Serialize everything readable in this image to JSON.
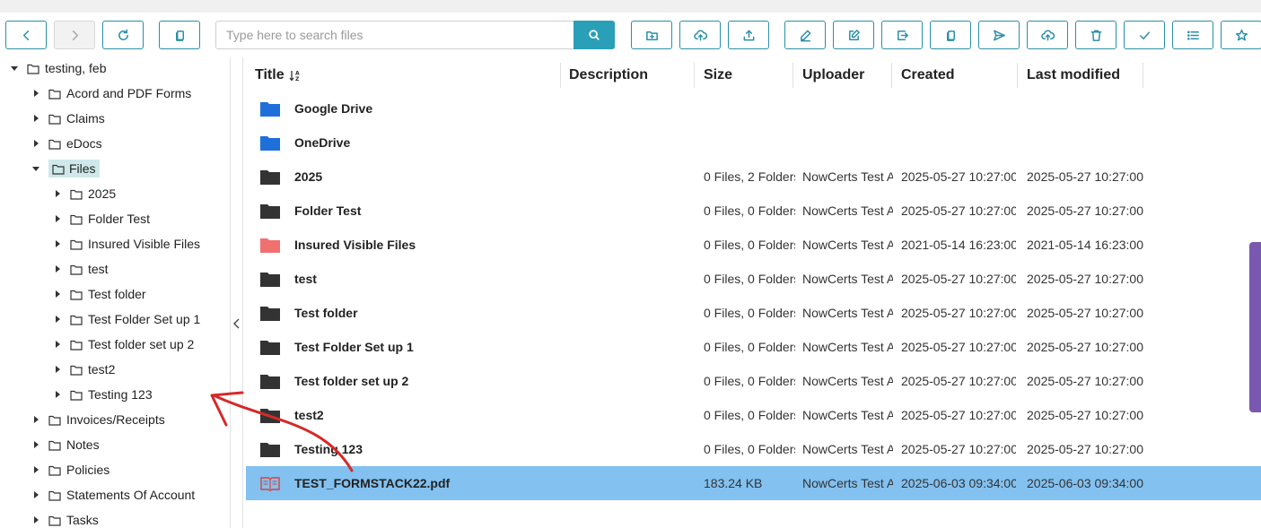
{
  "search": {
    "placeholder": "Type here to search files"
  },
  "toolbar": {
    "buttons": [
      {
        "name": "back-button",
        "icon": "chevron-left-icon"
      },
      {
        "name": "forward-button",
        "icon": "chevron-right-icon",
        "disabled": true
      },
      {
        "name": "refresh-button",
        "icon": "refresh-icon"
      },
      {
        "name": "copy-button",
        "icon": "copy-icon"
      },
      {
        "name": "new-folder-button",
        "icon": "folder-plus-icon"
      },
      {
        "name": "upload-cloud-button",
        "icon": "cloud-upload-icon"
      },
      {
        "name": "upload-button",
        "icon": "upload-icon"
      },
      {
        "name": "rename-button",
        "icon": "pencil-icon"
      },
      {
        "name": "edit-button",
        "icon": "edit-box-icon"
      },
      {
        "name": "move-button",
        "icon": "move-out-icon"
      },
      {
        "name": "duplicate-button",
        "icon": "duplicate-icon"
      },
      {
        "name": "send-button",
        "icon": "send-icon"
      },
      {
        "name": "download-cloud-button",
        "icon": "cloud-download-icon"
      },
      {
        "name": "delete-button",
        "icon": "trash-icon"
      },
      {
        "name": "select-button",
        "icon": "check-icon"
      },
      {
        "name": "list-view-button",
        "icon": "list-icon"
      },
      {
        "name": "favorite-button",
        "icon": "star-icon"
      }
    ]
  },
  "tree": {
    "root": "testing, feb",
    "top_folders": [
      "Acord and PDF Forms",
      "Claims",
      "eDocs"
    ],
    "files_folder": "Files",
    "files_children": [
      "2025",
      "Folder Test",
      "Insured Visible Files",
      "test",
      "Test folder",
      "Test Folder Set up 1",
      "Test folder set up 2",
      "test2",
      "Testing 123"
    ],
    "bottom_folders": [
      "Invoices/Receipts",
      "Notes",
      "Policies",
      "Statements Of Account",
      "Tasks"
    ]
  },
  "columns": {
    "title": "Title",
    "description": "Description",
    "size": "Size",
    "uploader": "Uploader",
    "created": "Created",
    "modified": "Last modified"
  },
  "rows": [
    {
      "title": "Google Drive",
      "icon": "blue-folder-icon",
      "size": "",
      "uploader": "",
      "created": "",
      "modified": ""
    },
    {
      "title": "OneDrive",
      "icon": "blue-folder-icon",
      "size": "",
      "uploader": "",
      "created": "",
      "modified": ""
    },
    {
      "title": "2025",
      "icon": "folder-icon",
      "size": "0 Files, 2 Folders",
      "uploader": "NowCerts Test A",
      "created": "2025-05-27 10:27:00",
      "modified": "2025-05-27 10:27:00"
    },
    {
      "title": "Folder Test",
      "icon": "folder-icon",
      "size": "0 Files, 0 Folders",
      "uploader": "NowCerts Test A",
      "created": "2025-05-27 10:27:00",
      "modified": "2025-05-27 10:27:00"
    },
    {
      "title": "Insured Visible Files",
      "icon": "pink-folder-icon",
      "size": "0 Files, 0 Folders",
      "uploader": "NowCerts Test A",
      "created": "2021-05-14 16:23:00",
      "modified": "2021-05-14 16:23:00"
    },
    {
      "title": "test",
      "icon": "folder-icon",
      "size": "0 Files, 0 Folders",
      "uploader": "NowCerts Test A",
      "created": "2025-05-27 10:27:00",
      "modified": "2025-05-27 10:27:00"
    },
    {
      "title": "Test folder",
      "icon": "folder-icon",
      "size": "0 Files, 0 Folders",
      "uploader": "NowCerts Test A",
      "created": "2025-05-27 10:27:00",
      "modified": "2025-05-27 10:27:00"
    },
    {
      "title": "Test Folder Set up 1",
      "icon": "folder-icon",
      "size": "0 Files, 0 Folders",
      "uploader": "NowCerts Test A",
      "created": "2025-05-27 10:27:00",
      "modified": "2025-05-27 10:27:00"
    },
    {
      "title": "Test folder set up 2",
      "icon": "folder-icon",
      "size": "0 Files, 0 Folders",
      "uploader": "NowCerts Test A",
      "created": "2025-05-27 10:27:00",
      "modified": "2025-05-27 10:27:00"
    },
    {
      "title": "test2",
      "icon": "folder-icon",
      "size": "0 Files, 0 Folders",
      "uploader": "NowCerts Test A",
      "created": "2025-05-27 10:27:00",
      "modified": "2025-05-27 10:27:00"
    },
    {
      "title": "Testing 123",
      "icon": "folder-icon",
      "size": "0 Files, 0 Folders",
      "uploader": "NowCerts Test A",
      "created": "2025-05-27 10:27:00",
      "modified": "2025-05-27 10:27:00"
    },
    {
      "title": "TEST_FORMSTACK22.pdf",
      "icon": "pdf-file-icon",
      "size": "183.24 KB",
      "uploader": "NowCerts Test A",
      "created": "2025-06-03 09:34:00",
      "modified": "2025-06-03 09:34:00",
      "selected": true
    }
  ],
  "colors": {
    "accent": "#2a8fa8",
    "search_button": "#2a9fb8",
    "selected_row": "#82c1f0",
    "tree_selected": "#cfe8ea",
    "side_tab": "#7b58b0",
    "annotation_arrow": "#d42a2a"
  }
}
